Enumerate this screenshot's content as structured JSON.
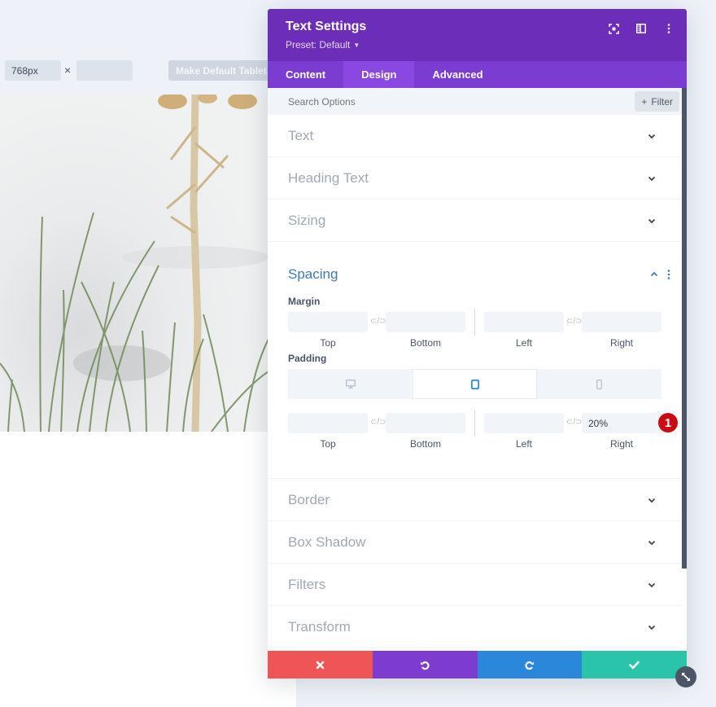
{
  "toolbar": {
    "width_value": "768px",
    "height_value": "",
    "times_symbol": "×",
    "make_default_label": "Make Default Tablet V"
  },
  "modal": {
    "title": "Text Settings",
    "preset": "Preset: Default",
    "header_icons": [
      "focus-icon",
      "split-view-icon",
      "more-vertical-icon"
    ],
    "tabs": [
      {
        "label": "Content",
        "active": false
      },
      {
        "label": "Design",
        "active": true
      },
      {
        "label": "Advanced",
        "active": false
      }
    ],
    "search_placeholder": "Search Options",
    "filter_label": "Filter",
    "sections_before": [
      {
        "title": "Text"
      },
      {
        "title": "Heading Text"
      },
      {
        "title": "Sizing"
      }
    ],
    "spacing": {
      "title": "Spacing",
      "margin": {
        "label": "Margin",
        "top": "",
        "bottom": "",
        "left": "",
        "right": "",
        "labels": [
          "Top",
          "Bottom",
          "Left",
          "Right"
        ]
      },
      "padding": {
        "label": "Padding",
        "devices": [
          {
            "name": "desktop",
            "active": false
          },
          {
            "name": "tablet",
            "active": true
          },
          {
            "name": "phone",
            "active": false
          }
        ],
        "top": "",
        "bottom": "",
        "left": "",
        "right": "20%",
        "labels": [
          "Top",
          "Bottom",
          "Left",
          "Right"
        ]
      },
      "step_badge": "1"
    },
    "sections_after": [
      {
        "title": "Border"
      },
      {
        "title": "Box Shadow"
      },
      {
        "title": "Filters"
      },
      {
        "title": "Transform"
      }
    ],
    "footer": {
      "cancel_color": "#ef5555",
      "undo_color": "#7e3bd0",
      "redo_color": "#2b87da",
      "save_color": "#29c4a9"
    }
  },
  "colors": {
    "header": "#6c2eb9",
    "tabs": "#7b3cd1",
    "active_tab": "#8a47e2",
    "accent_blue": "#3e7bb5",
    "badge": "#cc0a14"
  }
}
